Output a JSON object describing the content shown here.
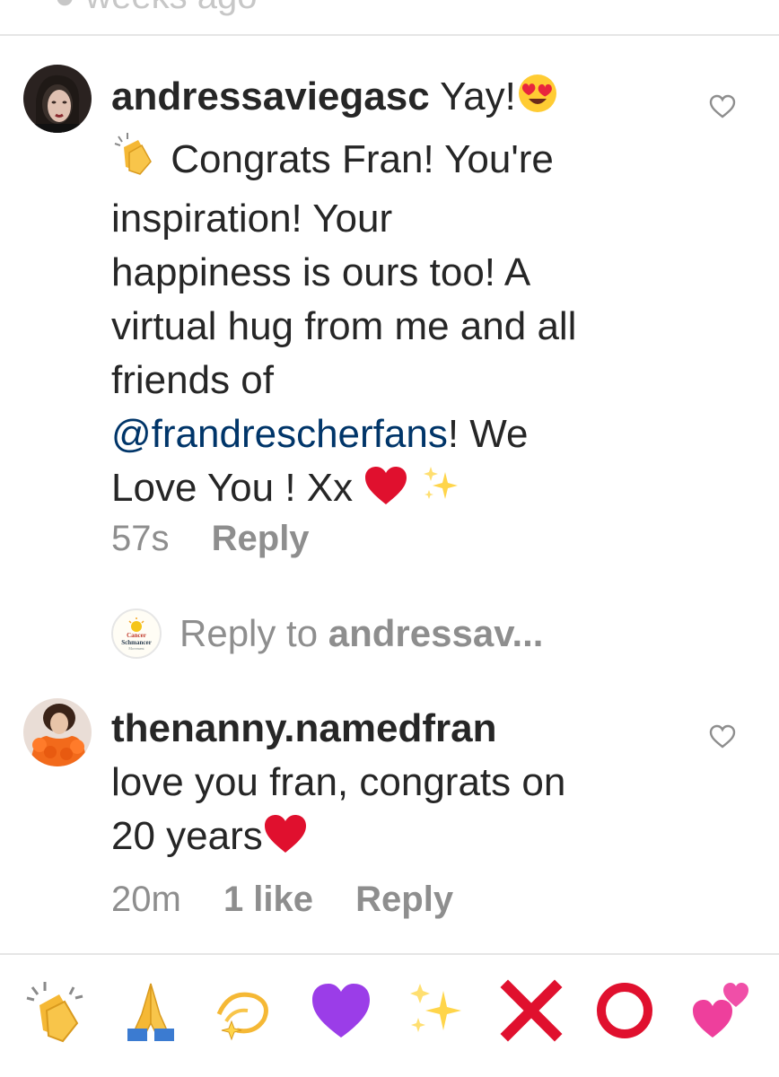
{
  "top_partial_text": "● weeks ago",
  "comments": [
    {
      "username": "andressaviegasc",
      "text_yay": "Yay!",
      "text_line1": "Congrats Fran! You're",
      "text_line2": "inspiration! Your",
      "text_line3": "happiness is ours too! A",
      "text_line4": "virtual hug from me and all",
      "text_line5": "friends of",
      "mention": "@frandrescherfans",
      "text_after_mention": "! We",
      "text_line7": "Love You ! Xx",
      "time": "57s",
      "reply_label": "Reply",
      "avatar_icon": "avatar-dark-hair-icon"
    },
    {
      "username": "thenanny.namedfran",
      "text_line1": "love you fran, congrats on",
      "text_line2": "20 years",
      "time": "20m",
      "likes": "1 like",
      "reply_label": "Reply",
      "avatar_icon": "avatar-orange-boa-icon"
    }
  ],
  "reply_input": {
    "placeholder_prefix": "Reply to ",
    "placeholder_target": "andressav...",
    "avatar_text_1": "Cancer",
    "avatar_text_2": "Schmancer",
    "avatar_text_3": "Movement"
  },
  "quick_emojis": [
    "clapping-hands-icon",
    "folded-hands-icon",
    "dizzy-icon",
    "purple-heart-icon",
    "sparkles-icon",
    "cross-mark-icon",
    "heavy-large-circle-icon",
    "two-hearts-icon"
  ],
  "colors": {
    "text": "#262626",
    "muted": "#8e8e8e",
    "mention": "#003569",
    "divider": "#e6e6e6"
  }
}
